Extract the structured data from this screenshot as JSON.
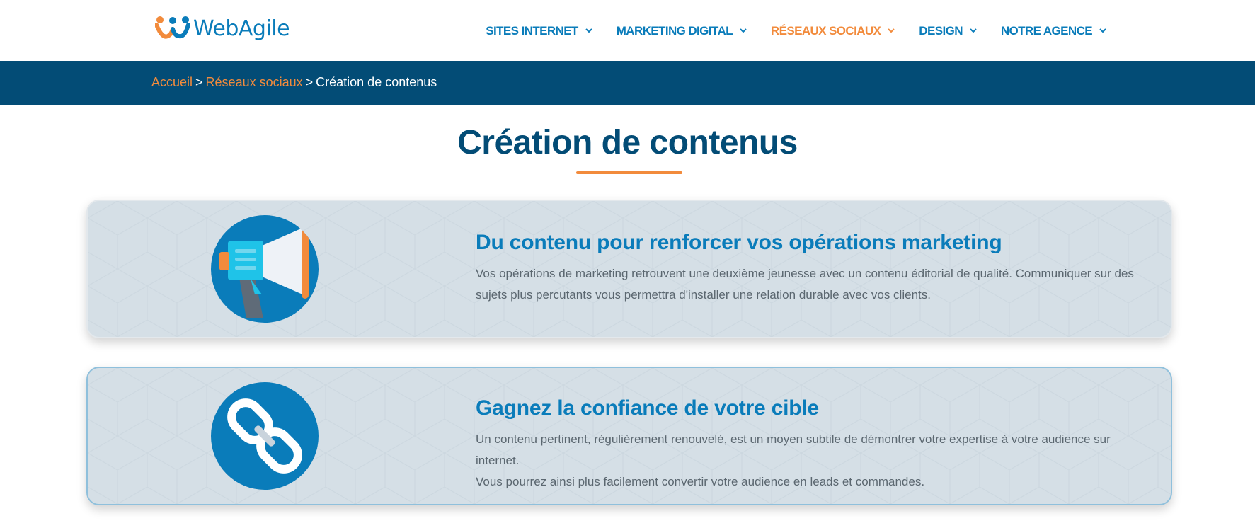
{
  "header": {
    "logo_text": "WebAgile",
    "nav": [
      {
        "label": "SITES INTERNET",
        "active": false
      },
      {
        "label": "MARKETING DIGITAL",
        "active": false
      },
      {
        "label": "RÉSEAUX SOCIAUX",
        "active": true
      },
      {
        "label": "DESIGN",
        "active": false
      },
      {
        "label": "NOTRE AGENCE",
        "active": false
      }
    ]
  },
  "breadcrumb": {
    "home": "Accueil",
    "section": "Réseaux sociaux",
    "separator": ">",
    "current": "Création de contenus"
  },
  "page": {
    "title": "Création de contenus"
  },
  "cards": [
    {
      "icon": "megaphone-icon",
      "heading": "Du contenu pour renforcer vos opérations marketing",
      "text": "Vos opérations de marketing retrouvent une deuxième jeunesse avec un contenu éditorial de qualité. Communiquer sur des sujets plus percutants vous permettra d'installer une relation durable avec vos clients."
    },
    {
      "icon": "chain-link-icon",
      "heading": "Gagnez la confiance de votre cible",
      "text": "Un contenu pertinent, régulièrement renouvelé, est un moyen subtile de démontrer votre expertise à votre audience sur internet.",
      "text2": "Vous pourrez ainsi plus facilement convertir votre audience en leads et commandes."
    }
  ],
  "colors": {
    "primary": "#0a7cba",
    "dark_blue": "#034c76",
    "accent_orange": "#f28b3c",
    "card_bg": "#d5dfe6",
    "body_text": "#5b6770"
  }
}
